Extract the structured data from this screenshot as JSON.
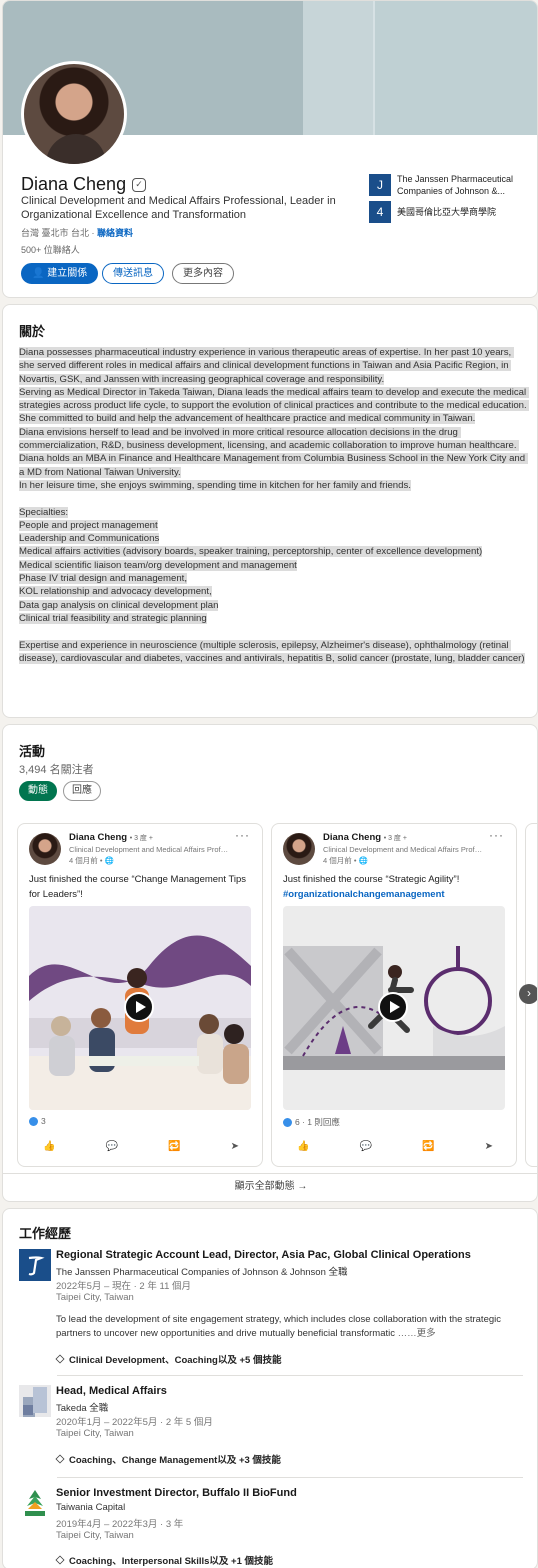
{
  "profile": {
    "name": "Diana Cheng",
    "verified_glyph": "✓",
    "headline": "Clinical Development and Medical Affairs Professional, Leader in Organizational Excellence and Transformation",
    "location": "台灣 臺北市 台北",
    "contact_link": "聯絡資料",
    "connections": "500+ 位聯絡人",
    "buttons": {
      "connect": "建立關係",
      "message": "傳送訊息",
      "more": "更多內容"
    },
    "orgs": [
      {
        "name": "The Janssen Pharmaceutical Companies of Johnson &...",
        "logo": "J"
      },
      {
        "name": "美國哥倫比亞大學商學院",
        "logo": "4"
      }
    ]
  },
  "about": {
    "title": "關於",
    "text": "Diana possesses pharmaceutical industry experience in various therapeutic areas of expertise. In her past 10 years, she served different roles in medical affairs and clinical development functions in Taiwan and Asia Pacific Region, in Novartis, GSK, and Janssen with increasing geographical coverage and responsibility.\nServing as Medical Director in Takeda Taiwan, Diana leads the medical affairs team to develop and execute the medical strategies across product life cycle, to support the evolution of clinical practices and contribute to the medical education. She committed to build and help the advancement of healthcare practice and medical community in Taiwan.\nDiana envisions herself to lead and be involved in more critical resource allocation decisions in the drug commercialization, R&D, business development, licensing, and academic collaboration to improve human healthcare. Diana holds an MBA in Finance and Healthcare Management from Columbia Business School in the New York City and a MD from National Taiwan University.\nIn her leisure time, she enjoys swimming, spending time in kitchen for her family and friends.\n\nSpecialties:\nPeople and project management\nLeadership and Communications\nMedical affairs activities (advisory boards, speaker training, perceptorship, center of excellence development)\nMedical scientific liaison team/org development and management\nPhase IV trial design and management,\nKOL relationship and advocacy development,\nData gap analysis on clinical development plan\nClinical trial feasibility and strategic planning\n\nExpertise and experience in neuroscience (multiple sclerosis, epilepsy, Alzheimer's disease), ophthalmology (retinal disease), cardiovascular and diabetes, vaccines and antivirals, hepatitis B, solid cancer (prostate, lung, bladder cancer)"
  },
  "activity": {
    "title": "活動",
    "followers": "3,494 名關注者",
    "tabs": [
      "動態",
      "回應"
    ],
    "posts": [
      {
        "author": "Diana Cheng",
        "degree": "• 3 度 +",
        "subtitle": "Clinical Development and Medical Affairs Professional",
        "time": "4 個月前 • 🌐",
        "text": "Just finished the course “Change Management Tips for Leaders”!",
        "hashtag": "",
        "reactions": "3"
      },
      {
        "author": "Diana Cheng",
        "degree": "• 3 度 +",
        "subtitle": "Clinical Development and Medical Affairs Professional",
        "time": "4 個月前 • 🌐",
        "text": "Just finished the course “Strategic Agility”!",
        "hashtag": "#organizationalchangemanagement",
        "reactions": "6 · 1 則回應"
      }
    ],
    "show_all": "顯示全部動態 →",
    "next_glyph": "›",
    "menu_glyph": "···",
    "action_glyphs": [
      "👍",
      "💬",
      "🔁",
      "➤"
    ]
  },
  "experience": {
    "title": "工作經歷",
    "jobs": [
      {
        "title": "Regional Strategic Account Lead, Director, Asia Pac, Global Clinical Operations",
        "company": "The Janssen Pharmaceutical Companies of Johnson & Johnson 全職",
        "dates": "2022年5月 – 現在 · 2 年 11 個月",
        "location": "Taipei City, Taiwan",
        "description": "To lead the development of site engagement strategy, which includes close collaboration with the strategic partners to uncover new opportunities and drive mutually beneficial transformatic",
        "more": "……更多",
        "skills": "Clinical Development、Coaching以及 +5 個技能"
      },
      {
        "title": "Head, Medical Affairs",
        "company": "Takeda 全職",
        "dates": "2020年1月 – 2022年5月 · 2 年 5 個月",
        "location": "Taipei City, Taiwan",
        "skills": "Coaching、Change Management以及 +3 個技能"
      },
      {
        "title": "Senior Investment Director, Buffalo II BioFund",
        "company": "Taiwania Capital",
        "dates": "2019年4月 – 2022年3月 · 3 年",
        "location": "Taipei City, Taiwan",
        "skills": "Coaching、Interpersonal Skills以及 +1 個技能"
      }
    ]
  },
  "colors": {
    "accent": "#0a66c2",
    "green": "#01754f",
    "banner": "#a9bbbf"
  }
}
